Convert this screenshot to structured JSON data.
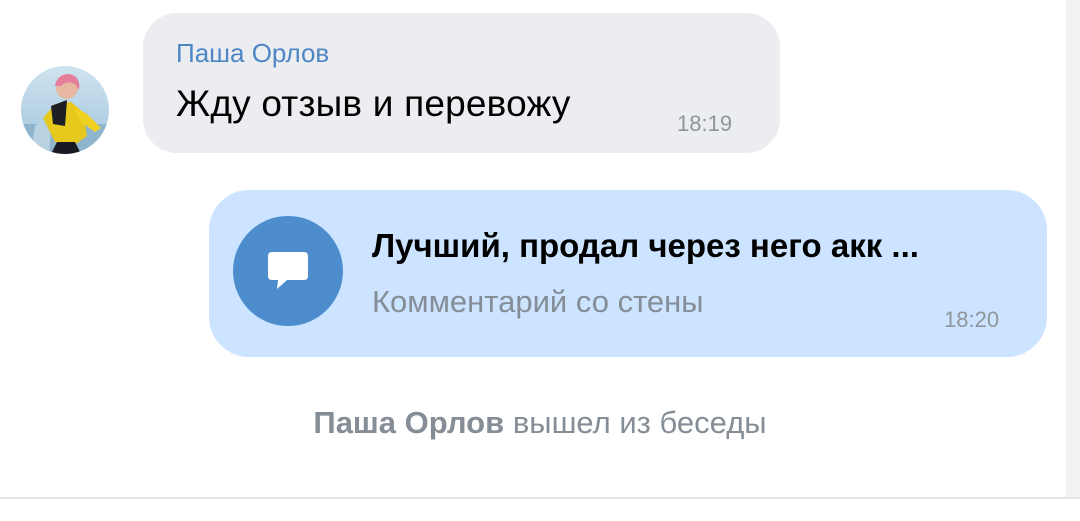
{
  "incoming_message": {
    "sender": "Паша Орлов",
    "text": "Жду отзыв и перевожу",
    "time": "18:19"
  },
  "outgoing_message": {
    "attachment_icon": "comment-bubble-icon",
    "title": "Лучший, продал через него акк ...",
    "subtitle": "Комментарий со стены",
    "time": "18:20"
  },
  "service_message": {
    "user": "Паша Орлов",
    "action": "вышел из беседы"
  },
  "colors": {
    "sender_name": "#4f86c6",
    "incoming_bubble": "#ebedf0",
    "outgoing_bubble": "#cce4ff",
    "attachment_icon_bg": "#4d8ccd",
    "muted_text": "#858d96"
  }
}
